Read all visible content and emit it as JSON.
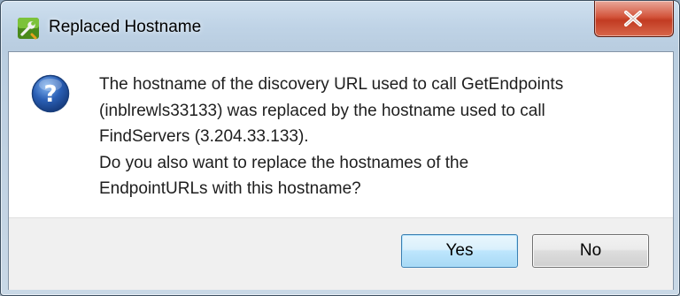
{
  "dialog": {
    "title": "Replaced Hostname",
    "icon": "wrench-app-icon",
    "message_icon": "question-icon",
    "message_lines": [
      "The hostname of the discovery URL used to call GetEndpoints",
      "(inblrewls33133) was replaced by the hostname used to call",
      "FindServers (3.204.33.133).",
      "Do you also want to replace the hostnames of the",
      "EndpointURLs with this hostname?"
    ],
    "buttons": {
      "yes_label": "Yes",
      "no_label": "No"
    }
  },
  "colors": {
    "close_button": "#c8442a",
    "default_button_border": "#3c7fb1",
    "question_icon": "#2a5fb5"
  }
}
